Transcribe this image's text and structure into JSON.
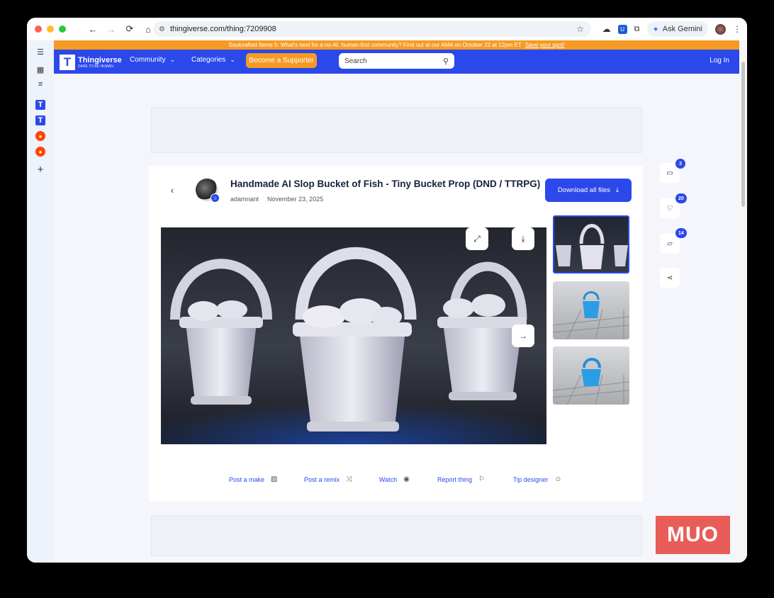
{
  "browser": {
    "url": "thingiverse.com/thing:7209908",
    "gemini_label": "Ask Gemini"
  },
  "banner": {
    "text": "Soulcrafted Items 5: What's next for a no-AI, human-first community? Find out at our AMA on October 22 at 12pm ET.",
    "link": "Save your spot!"
  },
  "nav": {
    "logo_title": "Thingiverse",
    "logo_tagline": "DARE TO BE HUMAN",
    "community": "Community",
    "categories": "Categories",
    "supporter": "Become a Supporter",
    "search_placeholder": "Search",
    "login": "Log In"
  },
  "thing": {
    "title": "Handmade AI Slop Bucket of Fish - Tiny Bucket Prop (DND / TTRPG)",
    "author": "adamnant",
    "date": "November 23, 2025",
    "download_all": "Download all files"
  },
  "actions": [
    {
      "label": "Post a make",
      "icon": "image-icon"
    },
    {
      "label": "Post a remix",
      "icon": "shuffle-icon"
    },
    {
      "label": "Watch",
      "icon": "eye-icon"
    },
    {
      "label": "Report thing",
      "icon": "flag-icon"
    },
    {
      "label": "Tip designer",
      "icon": "smile-icon"
    }
  ],
  "stats": {
    "comments": "3",
    "likes": "20",
    "collections": "14"
  },
  "watermark": "MUO",
  "colors": {
    "brand_blue": "#2b49ea",
    "accent_orange": "#f79a23"
  }
}
